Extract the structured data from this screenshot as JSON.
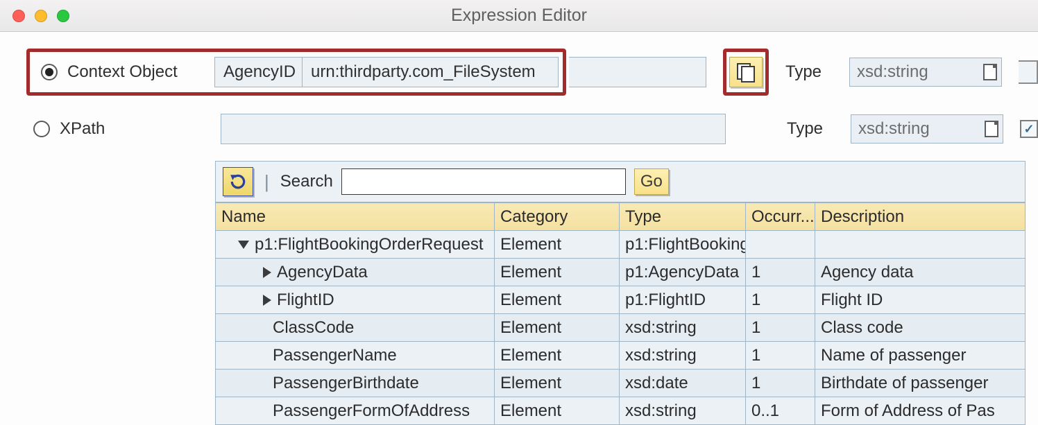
{
  "window": {
    "title": "Expression Editor"
  },
  "contextObject": {
    "label": "Context Object",
    "name": "AgencyID",
    "namespace": "urn:thirdparty.com_FileSystem",
    "typeLabel": "Type",
    "typeValue": "xsd:string"
  },
  "xpath": {
    "label": "XPath",
    "value": "",
    "typeLabel": "Type",
    "typeValue": "xsd:string"
  },
  "toolbar": {
    "searchLabel": "Search",
    "searchValue": "",
    "goLabel": "Go"
  },
  "tree": {
    "headers": {
      "name": "Name",
      "category": "Category",
      "type": "Type",
      "occurrence": "Occurr...",
      "description": "Description"
    },
    "rows": [
      {
        "indent": 1,
        "twisty": "down",
        "name": "p1:FlightBookingOrderRequest",
        "category": "Element",
        "type": "p1:FlightBooking",
        "occurrence": "",
        "description": ""
      },
      {
        "indent": 2,
        "twisty": "right",
        "name": "AgencyData",
        "category": "Element",
        "type": "p1:AgencyData",
        "occurrence": "1",
        "description": "Agency data"
      },
      {
        "indent": 2,
        "twisty": "right",
        "name": "FlightID",
        "category": "Element",
        "type": "p1:FlightID",
        "occurrence": "1",
        "description": "Flight ID"
      },
      {
        "indent": 3,
        "twisty": "",
        "name": "ClassCode",
        "category": "Element",
        "type": "xsd:string",
        "occurrence": "1",
        "description": "Class code"
      },
      {
        "indent": 3,
        "twisty": "",
        "name": "PassengerName",
        "category": "Element",
        "type": "xsd:string",
        "occurrence": "1",
        "description": "Name of passenger"
      },
      {
        "indent": 3,
        "twisty": "",
        "name": "PassengerBirthdate",
        "category": "Element",
        "type": "xsd:date",
        "occurrence": "1",
        "description": "Birthdate of passenger"
      },
      {
        "indent": 3,
        "twisty": "",
        "name": "PassengerFormOfAddress",
        "category": "Element",
        "type": "xsd:string",
        "occurrence": "0..1",
        "description": "Form of Address of Pas"
      }
    ]
  }
}
